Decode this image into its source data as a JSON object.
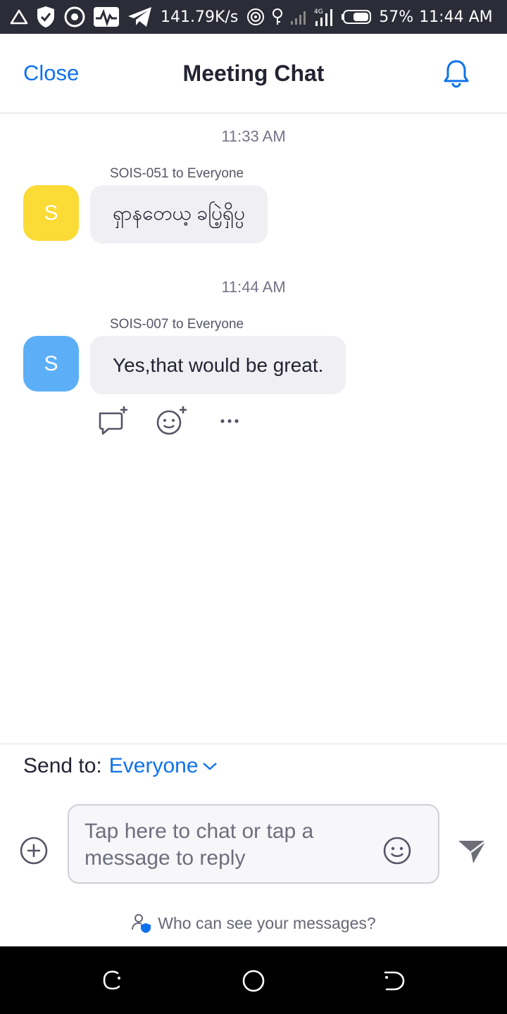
{
  "status_bar": {
    "speed": "141.79K/s",
    "battery": "57%",
    "time": "11:44 AM",
    "network_label": "4G"
  },
  "header": {
    "close_label": "Close",
    "title": "Meeting Chat"
  },
  "messages": [
    {
      "time": "11:33 AM",
      "sender": "SOIS-051 to Everyone",
      "avatar_letter": "S",
      "avatar_color": "#fbdb35",
      "text": "ရှာနတေယ့ ခပြဲ့ရှိပ္ပ"
    },
    {
      "time": "11:44 AM",
      "sender": "SOIS-007 to Everyone",
      "avatar_letter": "S",
      "avatar_color": "#5caff7",
      "text": "Yes,that would be great."
    }
  ],
  "composer": {
    "send_to_label": "Send to:",
    "send_to_value": "Everyone",
    "input_placeholder": "Tap here to chat or tap a message to reply",
    "privacy_text": "Who can see your messages?"
  },
  "colors": {
    "accent": "#0e72ed",
    "status_bar_bg": "#2c2c38",
    "bubble_bg": "#f0f0f4"
  }
}
